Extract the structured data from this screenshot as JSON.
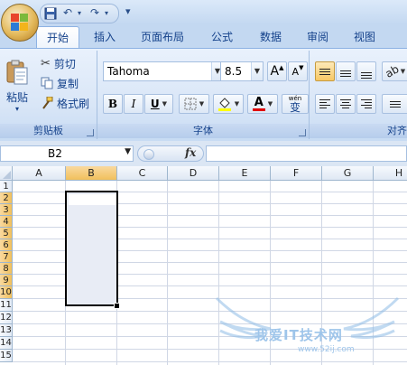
{
  "qat": {
    "save_icon": "save-icon",
    "undo_icon": "undo-icon",
    "redo_icon": "redo-icon",
    "customize": "▾"
  },
  "tabs": [
    {
      "label": "开始",
      "active": true
    },
    {
      "label": "插入"
    },
    {
      "label": "页面布局"
    },
    {
      "label": "公式"
    },
    {
      "label": "数据"
    },
    {
      "label": "审阅"
    },
    {
      "label": "视图"
    }
  ],
  "ribbon": {
    "clipboard": {
      "label": "剪贴板",
      "paste": "粘贴",
      "cut": "剪切",
      "copy": "复制",
      "format_painter": "格式刷"
    },
    "font": {
      "label": "字体",
      "font_name": "Tahoma",
      "font_size": "8.5",
      "grow": "A",
      "shrink": "A",
      "bold": "B",
      "italic": "I",
      "underline": "U",
      "font_color_glyph": "A",
      "phonetic": "wén",
      "phonetic_char": "变"
    },
    "alignment": {
      "label": "对齐"
    }
  },
  "formula_bar": {
    "name_box": "B2",
    "fx": "fx",
    "formula": ""
  },
  "sheet": {
    "columns": [
      "A",
      "B",
      "C",
      "D",
      "E",
      "F",
      "G",
      "H"
    ],
    "rows": [
      "1",
      "2",
      "3",
      "4",
      "5",
      "6",
      "7",
      "8",
      "9",
      "10",
      "11",
      "12",
      "13",
      "14",
      "15"
    ],
    "selected_column": "B",
    "selected_rows_range": "B2:B10"
  },
  "watermark": {
    "text": "我爱IT技术网",
    "url": "www.52ij.com"
  },
  "colors": {
    "ribbon_bg": "#dbe7f6",
    "accent": "#15428b",
    "selection_border": "#000000"
  }
}
